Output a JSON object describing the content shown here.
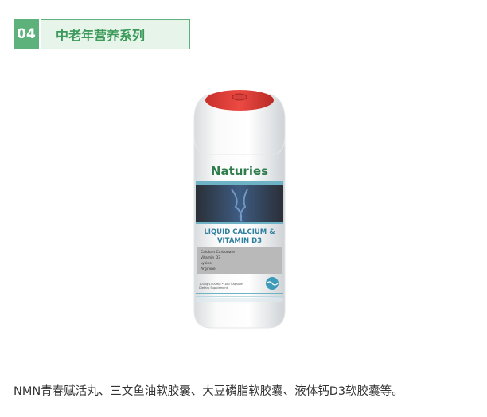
{
  "section": {
    "number": "04",
    "title": "中老年营养系列"
  },
  "product": {
    "brand": "Naturies",
    "name_line1": "LIQUID CALCIUM &",
    "name_line2": "VITAMIN D3",
    "ingredients": [
      "Calcium Carbonate",
      "Vitamin D3",
      "Lysine",
      "Arginine"
    ],
    "footer_line1": "1000g/1500mg • 180 Capsules",
    "footer_line2": "Dietary Supplement"
  },
  "caption": "NMN青春赋活丸、三文鱼油软胶囊、大豆磷脂软胶囊、液体钙D3软胶囊等。"
}
